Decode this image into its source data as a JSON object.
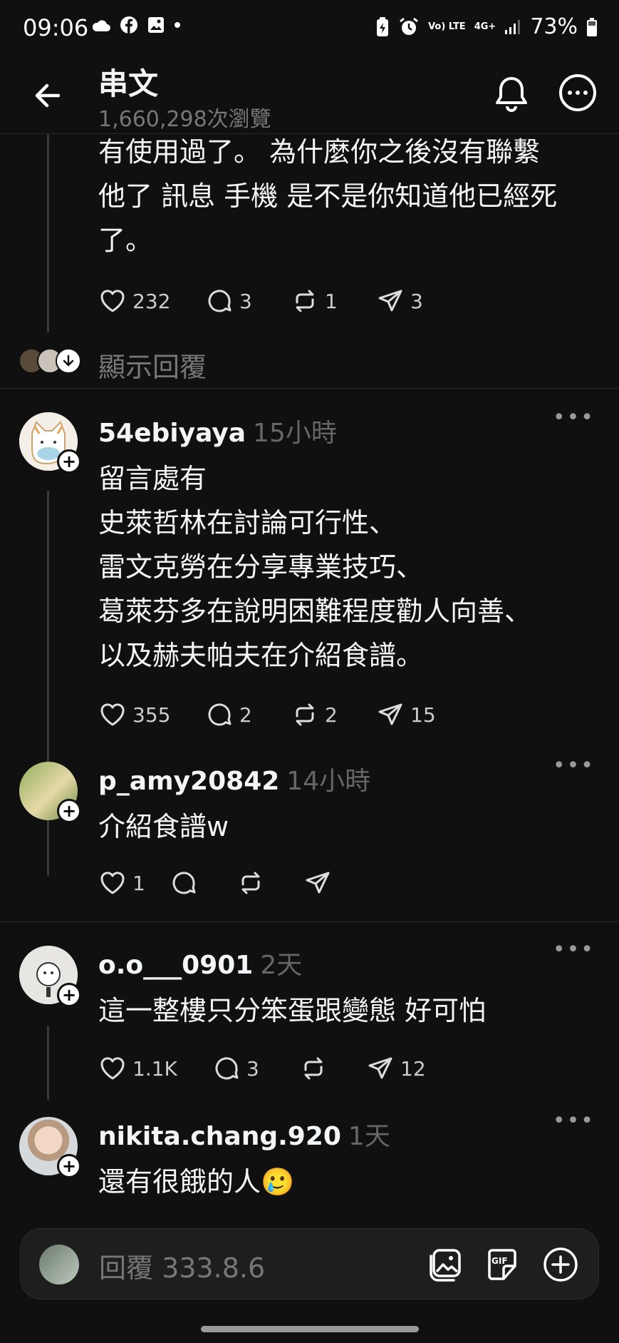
{
  "status_bar": {
    "time": "09:06",
    "battery": "73%",
    "network_a": "Vo) LTE",
    "network_b": "4G+"
  },
  "header": {
    "title": "串文",
    "views": "1,660,298次瀏覽"
  },
  "posts": [
    {
      "text": "有使用過了。 為什麼你之後沒有聯繫\n他了 訊息 手機 是不是你知道他已經死\n了。",
      "likes": "232",
      "comments": "3",
      "reposts": "1",
      "shares": "3"
    },
    {
      "username": "54ebiyaya",
      "time": "15小時",
      "text": "留言處有\n史萊哲林在討論可行性、\n雷文克勞在分享專業技巧、\n葛萊芬多在說明困難程度勸人向善、\n以及赫夫帕夫在介紹食譜。",
      "likes": "355",
      "comments": "2",
      "reposts": "2",
      "shares": "15"
    },
    {
      "username": "p_amy20842",
      "time": "14小時",
      "text": "介紹食譜w",
      "likes": "1",
      "comments": "",
      "reposts": "",
      "shares": ""
    },
    {
      "username": "o.o___0901",
      "time": "2天",
      "text": "這一整樓只分笨蛋跟變態 好可怕",
      "likes": "1.1K",
      "comments": "3",
      "reposts": "",
      "shares": "12"
    },
    {
      "username": "nikita.chang.920",
      "time": "1天",
      "text": "還有很餓的人🥲"
    }
  ],
  "show_replies": "顯示回覆",
  "composer": {
    "placeholder": "回覆 333.8.6"
  },
  "icons": [
    "back-arrow-icon",
    "bell-icon",
    "more-icon",
    "heart-icon",
    "comment-icon",
    "repost-icon",
    "share-icon",
    "gallery-icon",
    "gif-icon",
    "plus-icon"
  ],
  "colors": {
    "background": "#101010",
    "text": "#f3f5f7",
    "muted": "#777777"
  }
}
